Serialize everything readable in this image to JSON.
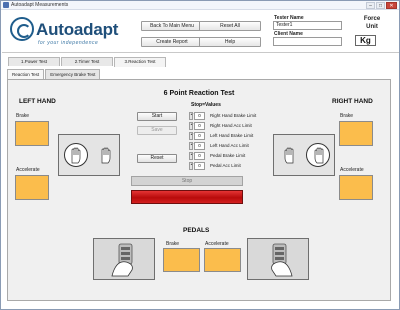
{
  "window": {
    "title": "Autoadapt Measurements"
  },
  "window_controls": {
    "minimize": "–",
    "maximize": "□",
    "close": "✕"
  },
  "logo": {
    "word": "Autoadapt",
    "tagline": "for your independence"
  },
  "header": {
    "back_button": "Back To Main Menu",
    "reset_all_button": "Reset All",
    "create_report_button": "Create Report",
    "help_button": "Help",
    "tester_label": "Tester Name",
    "tester_value": "Tester1",
    "client_label": "Client Name",
    "client_value": "",
    "force_unit_label": "Force Unit",
    "force_unit_value": "Kg"
  },
  "top_tabs": [
    {
      "label": "1.Power Test"
    },
    {
      "label": "2.Timer Test"
    },
    {
      "label": "3.Reaction Test"
    }
  ],
  "sub_tabs": [
    {
      "label": "Reaction Test"
    },
    {
      "label": "Emergency Brake Test"
    }
  ],
  "reaction": {
    "title": "6 Point Reaction Test",
    "left_hand_title": "LEFT HAND",
    "right_hand_title": "RIGHT HAND",
    "brake_label": "Brake",
    "accelerate_label": "Accelerate",
    "start_button": "Start",
    "save_button": "Save",
    "reset_button": "Reset",
    "stop_button": "Stop",
    "stop_values_header": "Stop=Values",
    "stop_rows": [
      {
        "value": "0",
        "label": "Right Hand Brake Limit"
      },
      {
        "value": "0",
        "label": "Right Hand Acc Limit"
      },
      {
        "value": "0",
        "label": "Left Hand Brake Limit"
      },
      {
        "value": "0",
        "label": "Left Hand Acc Limit"
      },
      {
        "value": "0",
        "label": "Pedal Brake Limit"
      },
      {
        "value": "0",
        "label": "Pedal Acc Limit"
      }
    ],
    "pedals_title": "PEDALS",
    "pedal_brake_label": "Brake",
    "pedal_accelerate_label": "Accelerate"
  },
  "icons": {
    "hand": "hand-icon",
    "pedal": "foot-pedal-icon"
  },
  "colors": {
    "value_box": "#fbbd4c",
    "stop_indicator": "#c41616",
    "logo": "#1f4f7a"
  }
}
